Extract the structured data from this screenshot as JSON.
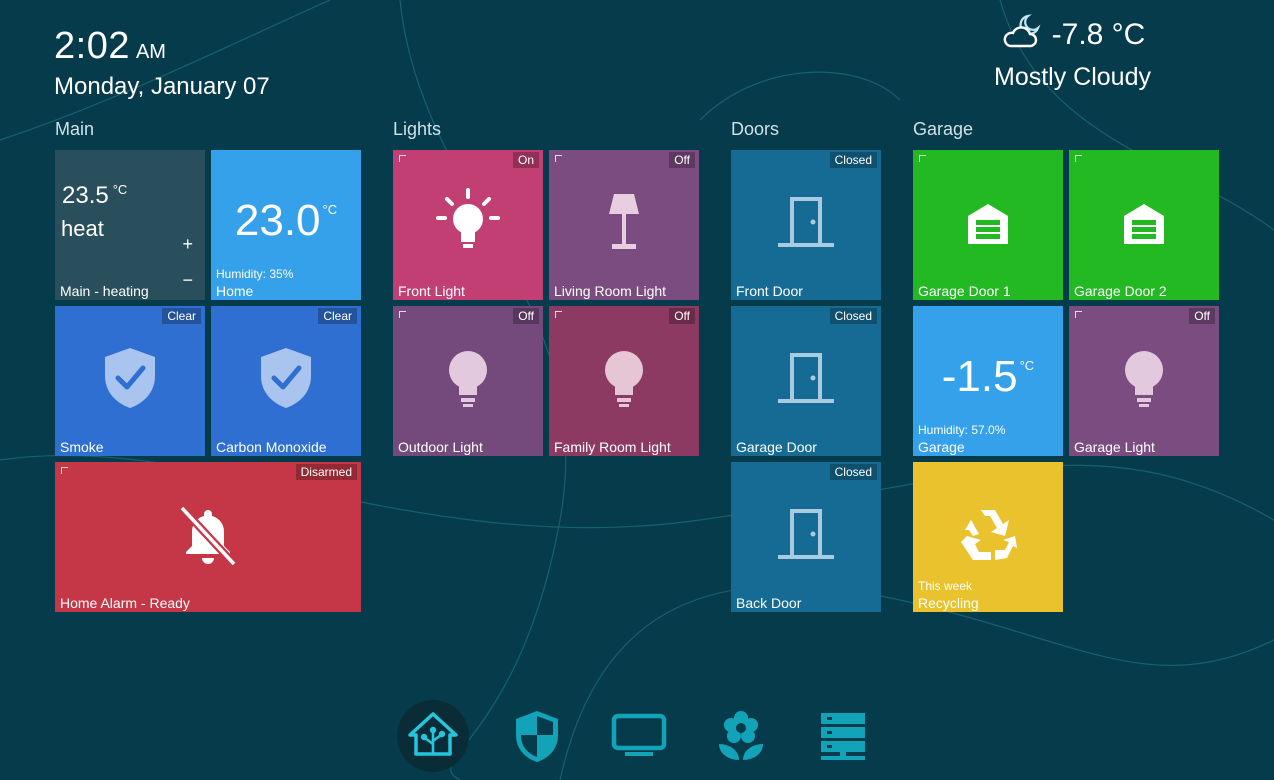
{
  "clock": {
    "time": "2:02",
    "ampm": "AM",
    "date": "Monday, January 07"
  },
  "weather": {
    "temperature": "-7.8 °C",
    "condition": "Mostly Cloudy",
    "icon": "moon-cloud-icon"
  },
  "groups": {
    "main": "Main",
    "lights": "Lights",
    "doors": "Doors",
    "garage": "Garage"
  },
  "tiles": {
    "thermostat": {
      "temp": "23.5",
      "unit": "°C",
      "mode": "heat",
      "plus": "+",
      "minus": "−",
      "title": "Main - heating",
      "color": "#2a4f5c"
    },
    "home_sensor": {
      "value": "23.0",
      "unit": "°C",
      "sub": "Humidity: 35%",
      "title": "Home",
      "color": "#35a1ea"
    },
    "smoke": {
      "badge": "Clear",
      "title": "Smoke",
      "color": "#2f6fd1",
      "icon": "shield-check-icon"
    },
    "co": {
      "badge": "Clear",
      "title": "Carbon Monoxide",
      "color": "#2f6fd1",
      "icon": "shield-check-icon"
    },
    "alarm": {
      "badge": "Disarmed",
      "title": "Home Alarm - Ready",
      "color": "#c53746",
      "icon": "bell-off-icon"
    },
    "front_light": {
      "badge": "On",
      "title": "Front Light",
      "color": "#c23f74",
      "icon": "lightbulb-on-icon"
    },
    "living_light": {
      "badge": "Off",
      "title": "Living Room Light",
      "color": "#7b4c80",
      "icon": "floor-lamp-icon"
    },
    "outdoor_light": {
      "badge": "Off",
      "title": "Outdoor Light",
      "color": "#744a7c",
      "icon": "lightbulb-icon"
    },
    "family_light": {
      "badge": "Off",
      "title": "Family Room Light",
      "color": "#8c3a62",
      "icon": "lightbulb-icon"
    },
    "front_door": {
      "badge": "Closed",
      "title": "Front Door",
      "color": "#166b95",
      "icon": "door-icon"
    },
    "garage_door_sensor": {
      "badge": "Closed",
      "title": "Garage Door",
      "color": "#166b95",
      "icon": "door-icon"
    },
    "back_door": {
      "badge": "Closed",
      "title": "Back Door",
      "color": "#166b95",
      "icon": "door-icon"
    },
    "garage_door_1": {
      "title": "Garage Door 1",
      "color": "#22b922",
      "icon": "garage-icon"
    },
    "garage_door_2": {
      "title": "Garage Door 2",
      "color": "#22b922",
      "icon": "garage-icon"
    },
    "garage_sensor": {
      "value": "-1.5",
      "unit": "°C",
      "sub": "Humidity: 57.0%",
      "title": "Garage",
      "color": "#35a1ea"
    },
    "garage_light": {
      "badge": "Off",
      "title": "Garage Light",
      "color": "#7b4c80",
      "icon": "lightbulb-icon"
    },
    "recycling": {
      "sub": "This week",
      "title": "Recycling",
      "color": "#e9c22e",
      "icon": "recycle-icon"
    }
  },
  "nav": {
    "items": [
      "home-assistant-icon",
      "shield-half-icon",
      "monitor-icon",
      "flower-icon",
      "server-icon"
    ],
    "accent": "#12a3b8"
  }
}
